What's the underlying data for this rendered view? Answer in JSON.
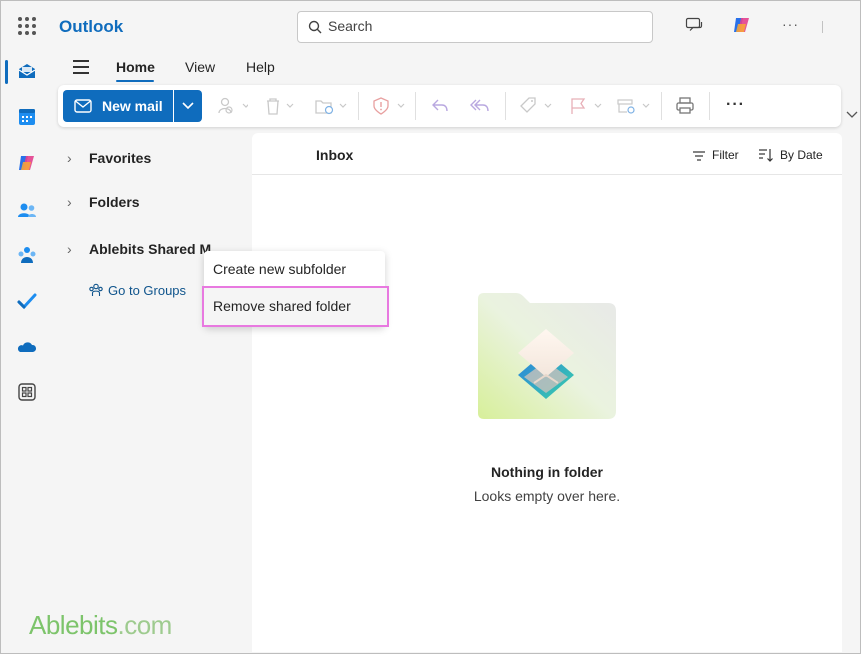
{
  "app": {
    "title": "Outlook"
  },
  "search": {
    "placeholder": "Search"
  },
  "tabs": [
    {
      "label": "Home",
      "active": true
    },
    {
      "label": "View"
    },
    {
      "label": "Help"
    }
  ],
  "ribbon": {
    "new_mail_label": "New mail",
    "more_label": "···"
  },
  "nav": {
    "items": [
      {
        "label": "Favorites"
      },
      {
        "label": "Folders"
      },
      {
        "label": "Ablebits Shared M"
      }
    ],
    "groups_link": "Go to Groups"
  },
  "context_menu": {
    "items": [
      {
        "label": "Create new subfolder"
      },
      {
        "label": "Remove shared folder",
        "highlighted": true
      }
    ]
  },
  "message_list": {
    "title": "Inbox",
    "filter_label": "Filter",
    "sort_label": "By Date",
    "empty_title": "Nothing in folder",
    "empty_subtitle": "Looks empty over here."
  },
  "watermark": {
    "text_a": "Ablebits",
    "text_b": ".com"
  },
  "colors": {
    "accent": "#0f6cbd",
    "highlight_outline": "#e879e0"
  }
}
